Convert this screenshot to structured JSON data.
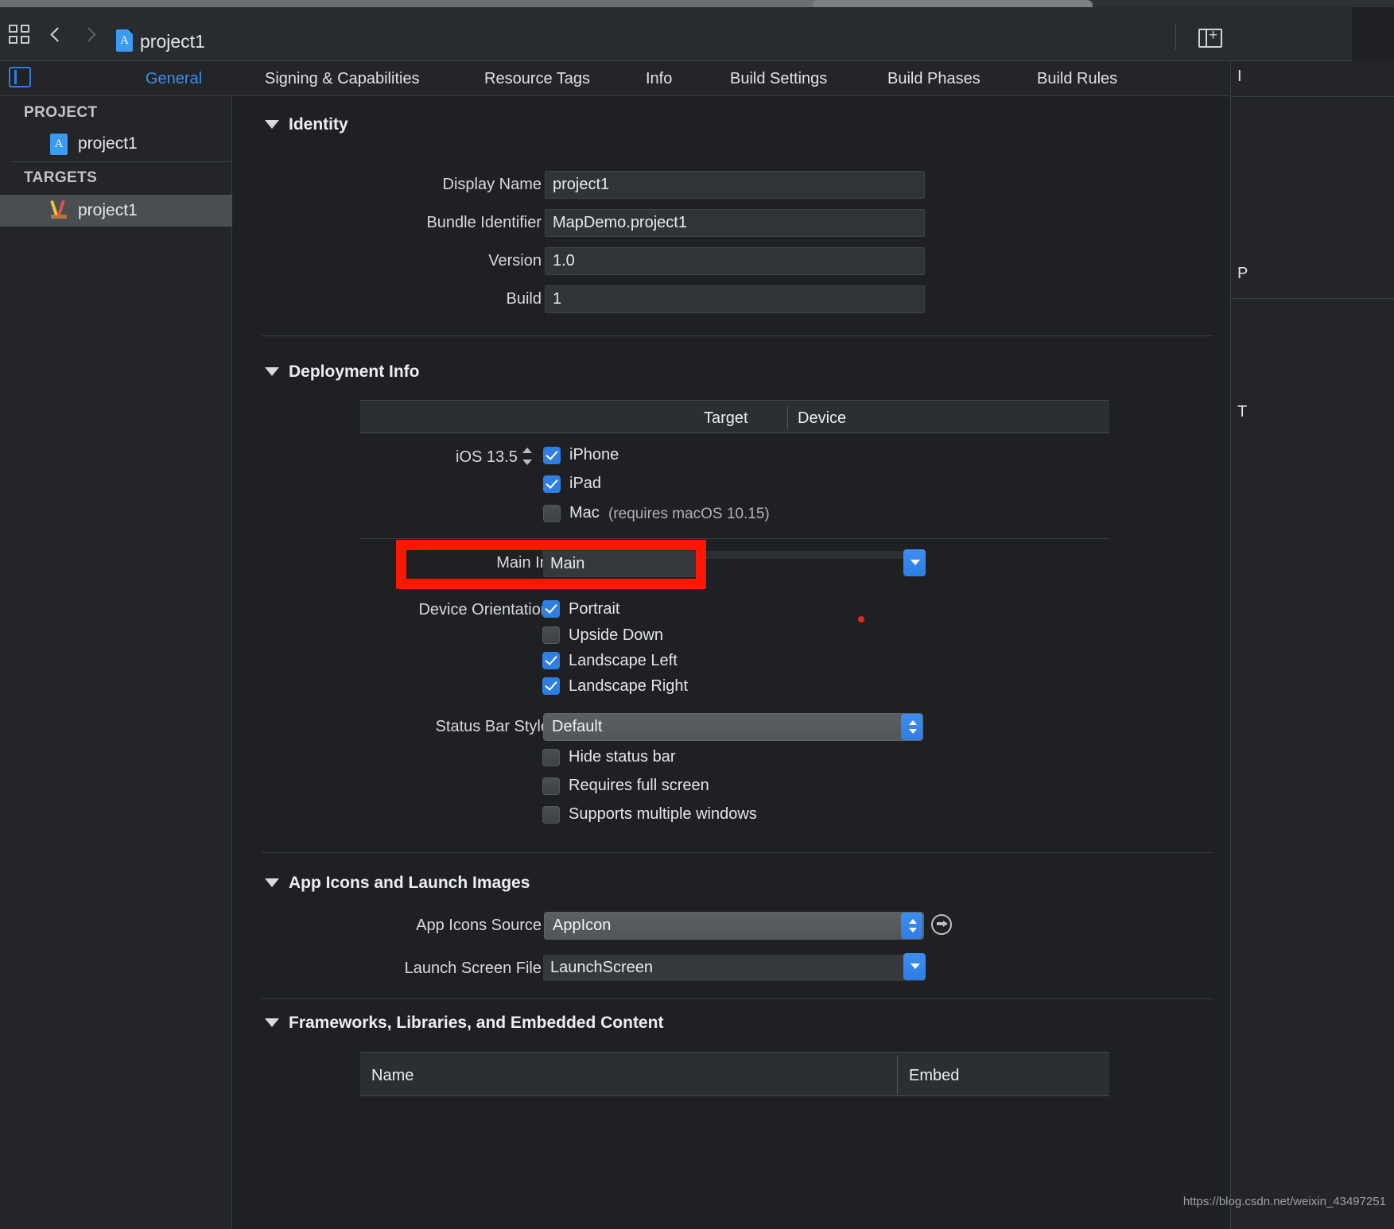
{
  "window": {
    "toolbar": {
      "title": "project1",
      "grid_icon": "grid-view-icon",
      "back_icon": "chevron-left-icon",
      "forward_icon": "chevron-right-icon",
      "project_icon": "xcode-project-icon",
      "panel_toggle_icon": "inspector-panel-toggle-icon"
    }
  },
  "tabs": [
    {
      "label": "General",
      "active": true
    },
    {
      "label": "Signing & Capabilities",
      "active": false
    },
    {
      "label": "Resource Tags",
      "active": false
    },
    {
      "label": "Info",
      "active": false
    },
    {
      "label": "Build Settings",
      "active": false
    },
    {
      "label": "Build Phases",
      "active": false
    },
    {
      "label": "Build Rules",
      "active": false
    }
  ],
  "sidebar": {
    "toggle_icon": "left-panel-toggle-icon",
    "sections": [
      {
        "header": "PROJECT",
        "items": [
          {
            "label": "project1",
            "icon": "xcode-project-icon",
            "selected": false
          }
        ]
      },
      {
        "header": "TARGETS",
        "items": [
          {
            "label": "project1",
            "icon": "app-target-icon",
            "selected": true
          }
        ]
      }
    ]
  },
  "sections": {
    "identity": {
      "title": "Identity",
      "fields": [
        {
          "label": "Display Name",
          "value": "project1"
        },
        {
          "label": "Bundle Identifier",
          "value": "MapDemo.project1"
        },
        {
          "label": "Version",
          "value": "1.0"
        },
        {
          "label": "Build",
          "value": "1"
        }
      ]
    },
    "deployment": {
      "title": "Deployment Info",
      "table_headers": {
        "target": "Target",
        "device": "Device"
      },
      "os_version": "iOS 13.5",
      "devices": [
        {
          "label": "iPhone",
          "checked": true,
          "note": ""
        },
        {
          "label": "iPad",
          "checked": true,
          "note": ""
        },
        {
          "label": "Mac",
          "checked": false,
          "note": "(requires macOS 10.15)"
        }
      ],
      "main_interface": {
        "label": "Main Interface",
        "value": "Main"
      },
      "device_orientation": {
        "label": "Device Orientation",
        "options": [
          {
            "label": "Portrait",
            "checked": true
          },
          {
            "label": "Upside Down",
            "checked": false
          },
          {
            "label": "Landscape Left",
            "checked": true
          },
          {
            "label": "Landscape Right",
            "checked": true
          }
        ]
      },
      "status_bar_style": {
        "label": "Status Bar Style",
        "value": "Default"
      },
      "status_options": [
        {
          "label": "Hide status bar",
          "checked": false
        },
        {
          "label": "Requires full screen",
          "checked": false
        },
        {
          "label": "Supports multiple windows",
          "checked": false
        }
      ]
    },
    "app_icons": {
      "title": "App Icons and Launch Images",
      "app_icons_source": {
        "label": "App Icons Source",
        "value": "AppIcon"
      },
      "launch_screen_file": {
        "label": "Launch Screen File",
        "value": "LaunchScreen"
      },
      "goto_icon": "arrow-right-circle-icon"
    },
    "frameworks": {
      "title": "Frameworks, Libraries, and Embedded Content",
      "columns": {
        "name": "Name",
        "embed": "Embed"
      }
    }
  },
  "annotation": {
    "highlight_color": "#fe1700",
    "dot_color": "#e02b1c"
  },
  "inspector": {
    "line1": "I",
    "line2": "P",
    "line3": "T"
  },
  "watermark": "https://blog.csdn.net/weixin_43497251"
}
